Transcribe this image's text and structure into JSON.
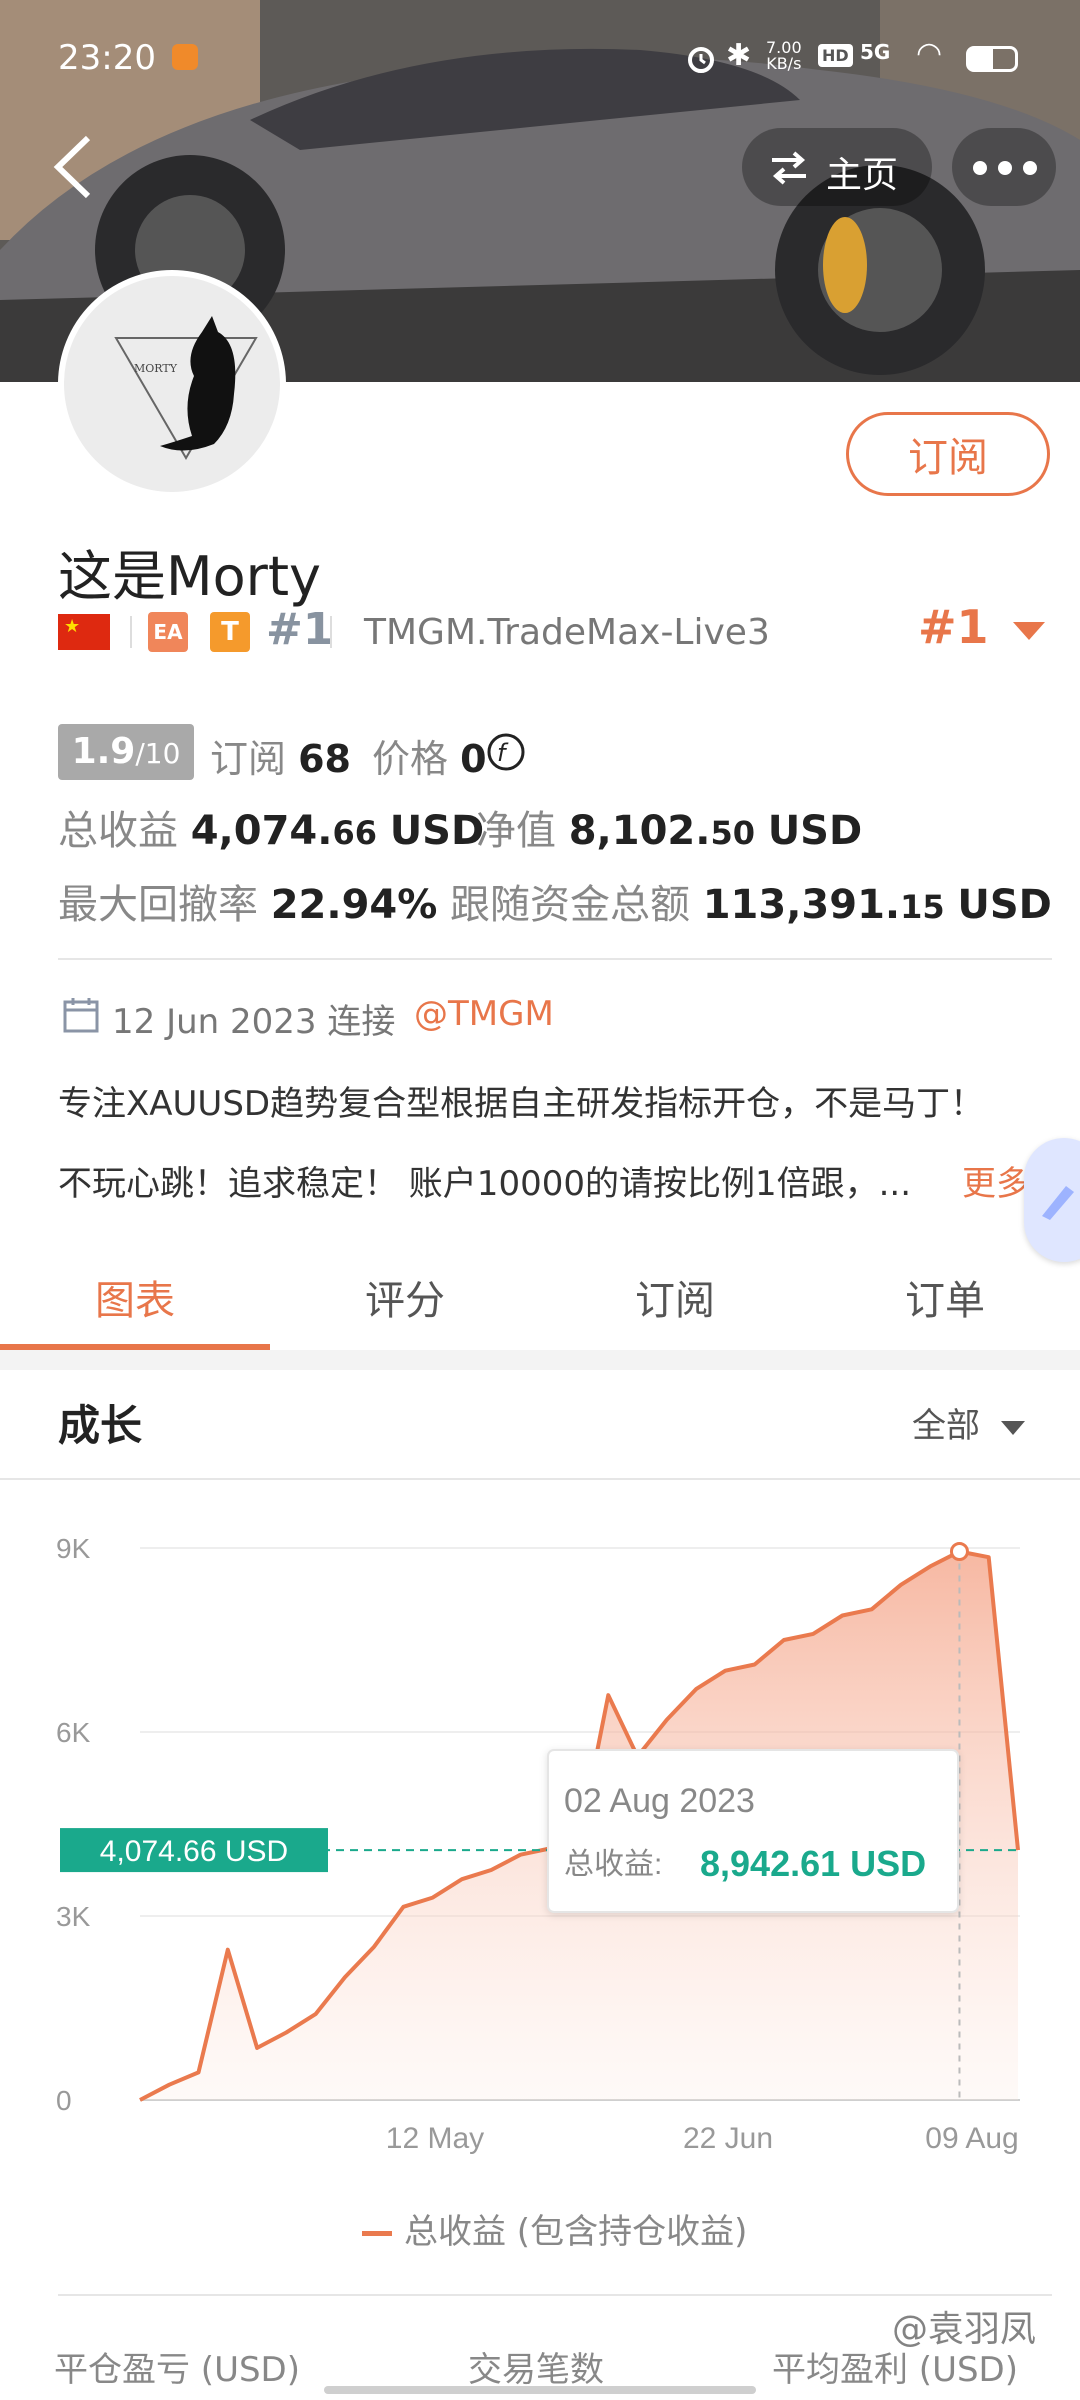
{
  "status_bar": {
    "time": "23:20",
    "net_speed": "7.00",
    "net_unit": "KB/s",
    "hd": "HD",
    "signal": "5G"
  },
  "header": {
    "home_label": "主页"
  },
  "profile": {
    "avatar_text": "MORTY",
    "subscribe_label": "订阅",
    "name": "这是Morty",
    "badge_ea": "EA",
    "badge_t": "T",
    "rank": "#1",
    "broker": "TMGM.TradeMax-Live3",
    "rank_right": "#1"
  },
  "stats": {
    "score": "1.9",
    "score_max": "/10",
    "subscribers_label": "订阅",
    "subscribers": "68",
    "price_label": "价格",
    "price": "0",
    "total_profit_label": "总收益",
    "total_profit_int": "4,074.",
    "total_profit_dec": "66",
    "total_profit_unit": "USD",
    "equity_label": "净值",
    "equity_int": "8,102.",
    "equity_dec": "50",
    "equity_unit": "USD",
    "drawdown_label": "最大回撤率",
    "drawdown": "22.94%",
    "follow_label": "跟随资金总额",
    "follow_int": "113,391.",
    "follow_dec": "15",
    "follow_unit": "USD"
  },
  "info": {
    "date": "12 Jun 2023 连接",
    "broker_tag": "@TMGM",
    "desc_line1": "专注XAUUSD趋势复合型根据自主研发指标开仓，不是马丁！",
    "desc_line2": "不玩心跳！追求稳定！ 账户10000的请按比例1倍跟，...",
    "more": "更多"
  },
  "tabs": [
    "图表",
    "评分",
    "订阅",
    "订单"
  ],
  "section": {
    "title": "成长",
    "filter": "全部"
  },
  "chart_data": {
    "type": "area",
    "title": "",
    "y_ticks": [
      "9K",
      "6K",
      "3K",
      "0"
    ],
    "x_ticks": [
      "12 May",
      "22 Jun",
      "09 Aug"
    ],
    "ylim": [
      0,
      9000
    ],
    "series": [
      {
        "name": "总收益 (包含持仓收益)",
        "values": [
          0,
          250,
          450,
          2450,
          850,
          1100,
          1400,
          2000,
          2500,
          3150,
          3300,
          3600,
          3750,
          4000,
          4100,
          4200,
          6600,
          5600,
          6200,
          6700,
          7000,
          7100,
          7500,
          7600,
          7900,
          8000,
          8400,
          8700,
          8942.61,
          8850,
          4074.66
        ]
      }
    ],
    "reference_line": {
      "label": "4,074.66 USD",
      "value": 4074.66
    },
    "tooltip": {
      "date": "02 Aug 2023",
      "label": "总收益:",
      "value": "8,942.61 USD"
    },
    "legend": "总收益 (包含持仓收益)",
    "colors": {
      "line": "#ea7a4e",
      "reference": "#1aa98c"
    }
  },
  "bottom_stats": [
    "平仓盈亏 (USD)",
    "交易笔数",
    "平均盈利 (USD)"
  ],
  "watermark": "@袁羽凤"
}
